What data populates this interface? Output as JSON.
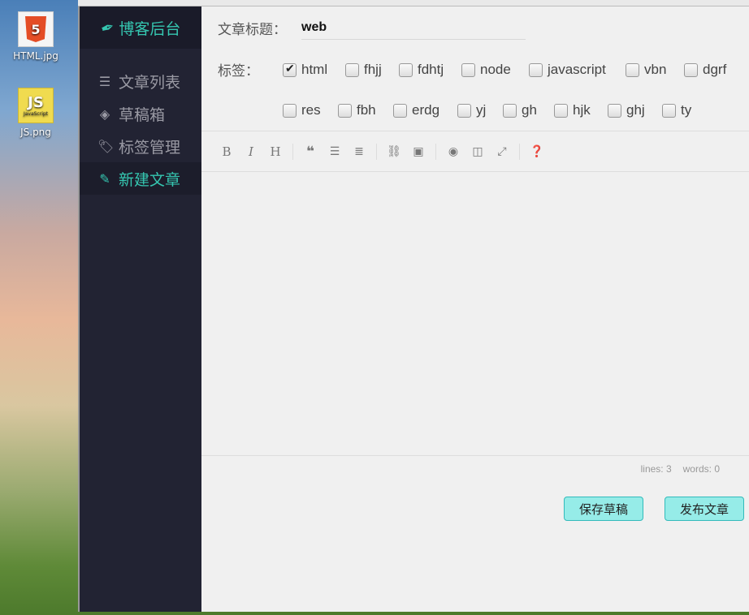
{
  "desktop": {
    "icons": [
      {
        "label": "HTML.jpg",
        "glyph": "5",
        "badge": "HTML"
      },
      {
        "label": "JS.png",
        "glyph": "JS",
        "sub": "JavaScript"
      }
    ]
  },
  "sidebar": {
    "brand": "博客后台",
    "items": [
      {
        "label": "文章列表",
        "icon": "list-icon"
      },
      {
        "label": "草稿箱",
        "icon": "layers-icon"
      },
      {
        "label": "标签管理",
        "icon": "tags-icon"
      },
      {
        "label": "新建文章",
        "icon": "new-document-icon",
        "active": true
      }
    ]
  },
  "form": {
    "title_label": "文章标题：",
    "title_value": "web",
    "tags_label": "标签：",
    "tags": [
      {
        "name": "html",
        "checked": true
      },
      {
        "name": "fhjj",
        "checked": false
      },
      {
        "name": "fdhtj",
        "checked": false
      },
      {
        "name": "node",
        "checked": false
      },
      {
        "name": "javascript",
        "checked": false
      },
      {
        "name": "vbn",
        "checked": false
      },
      {
        "name": "dgrf",
        "checked": false
      },
      {
        "name": "res",
        "checked": false
      },
      {
        "name": "fbh",
        "checked": false
      },
      {
        "name": "erdg",
        "checked": false
      },
      {
        "name": "yj",
        "checked": false
      },
      {
        "name": "gh",
        "checked": false
      },
      {
        "name": "hjk",
        "checked": false
      },
      {
        "name": "ghj",
        "checked": false
      },
      {
        "name": "ty",
        "checked": false
      }
    ]
  },
  "toolbar": {
    "bold": "B",
    "italic": "I",
    "heading": "H"
  },
  "editor": {
    "lines": "lines: 3",
    "words": "words: 0"
  },
  "actions": {
    "save_draft": "保存草稿",
    "publish": "发布文章"
  },
  "colors": {
    "accent": "#35c6b0",
    "sidebar_bg": "#222333",
    "button_bg": "#96ece8"
  }
}
